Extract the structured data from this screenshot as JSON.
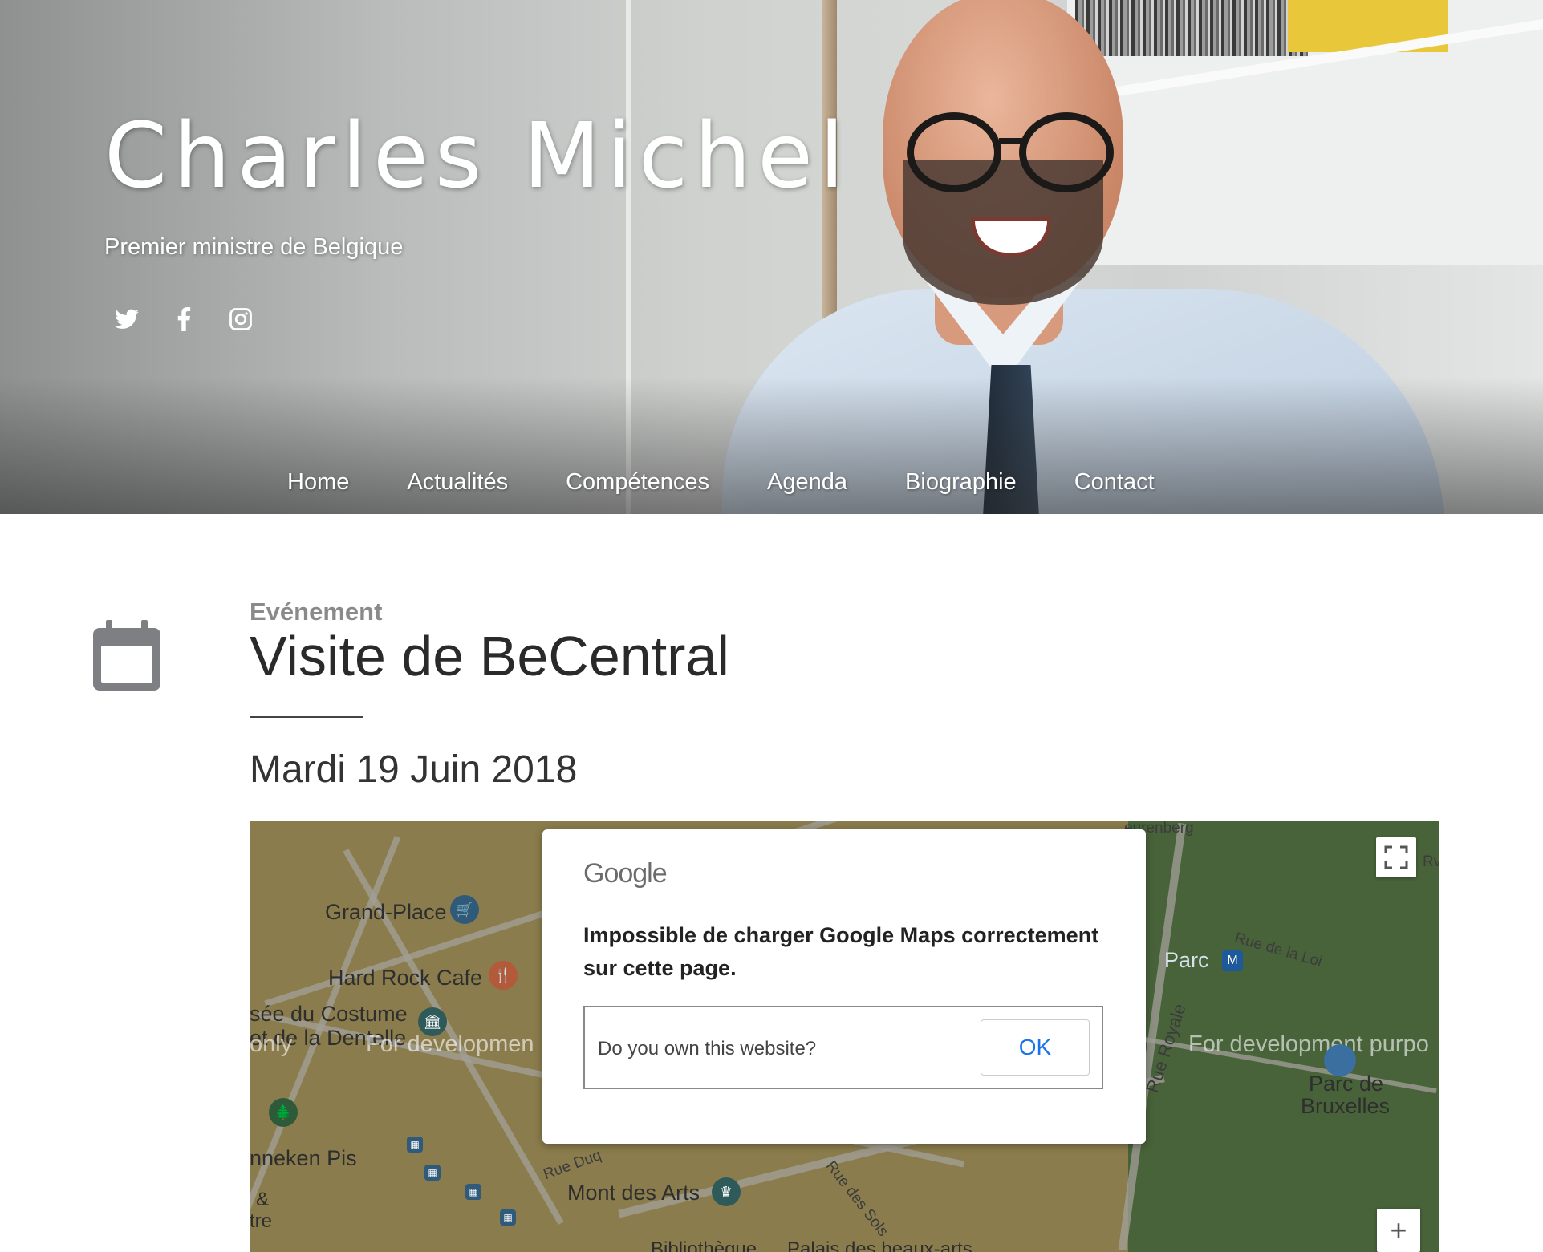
{
  "hero": {
    "title": "Charles Michel",
    "subtitle": "Premier ministre de Belgique",
    "social": [
      "twitter-icon",
      "facebook-icon",
      "instagram-icon"
    ]
  },
  "nav": {
    "items": [
      "Home",
      "Actualités",
      "Compétences",
      "Agenda",
      "Biographie",
      "Contact"
    ]
  },
  "event": {
    "type": "Evénement",
    "title": "Visite de BeCentral",
    "date": "Mardi 19 Juin 2018",
    "icon": "calendar-icon"
  },
  "map": {
    "labels": {
      "grand_place": "Grand-Place",
      "hard_rock": "Hard Rock Cafe",
      "musee1": "sée du Costume",
      "musee2": "et de la Dentelle",
      "only": "only",
      "dev_left": "For developmen",
      "dev_right": "For development purpo",
      "manneken": "nneken Pis",
      "amp": "&",
      "tre": "tre",
      "rue_duq": "Rue Duq",
      "mont_des_arts": "Mont des Arts",
      "rue_des_sols": "Rue des Sols",
      "bibliotheque": "Bibliothèque",
      "palais": "Palais des beaux-arts",
      "parc": "Parc",
      "rue_de_la_loi": "Rue de la Loi",
      "rue_royale": "Rue Royale",
      "parc_bruxelles1": "Parc de",
      "parc_bruxelles2": "Bruxelles",
      "eurenberg": "eurenberg",
      "rv": "Rv"
    },
    "zoom_in_label": "+",
    "fullscreen_icon": "fullscreen-icon"
  },
  "dialog": {
    "logo": "Google",
    "message": "Impossible de charger Google Maps correctement sur cette page.",
    "own_question": "Do you own this website?",
    "ok_label": "OK"
  },
  "colors": {
    "map_base": "#9c8a50",
    "park": "#4b6b3a",
    "ok_blue": "#1a73e8"
  }
}
